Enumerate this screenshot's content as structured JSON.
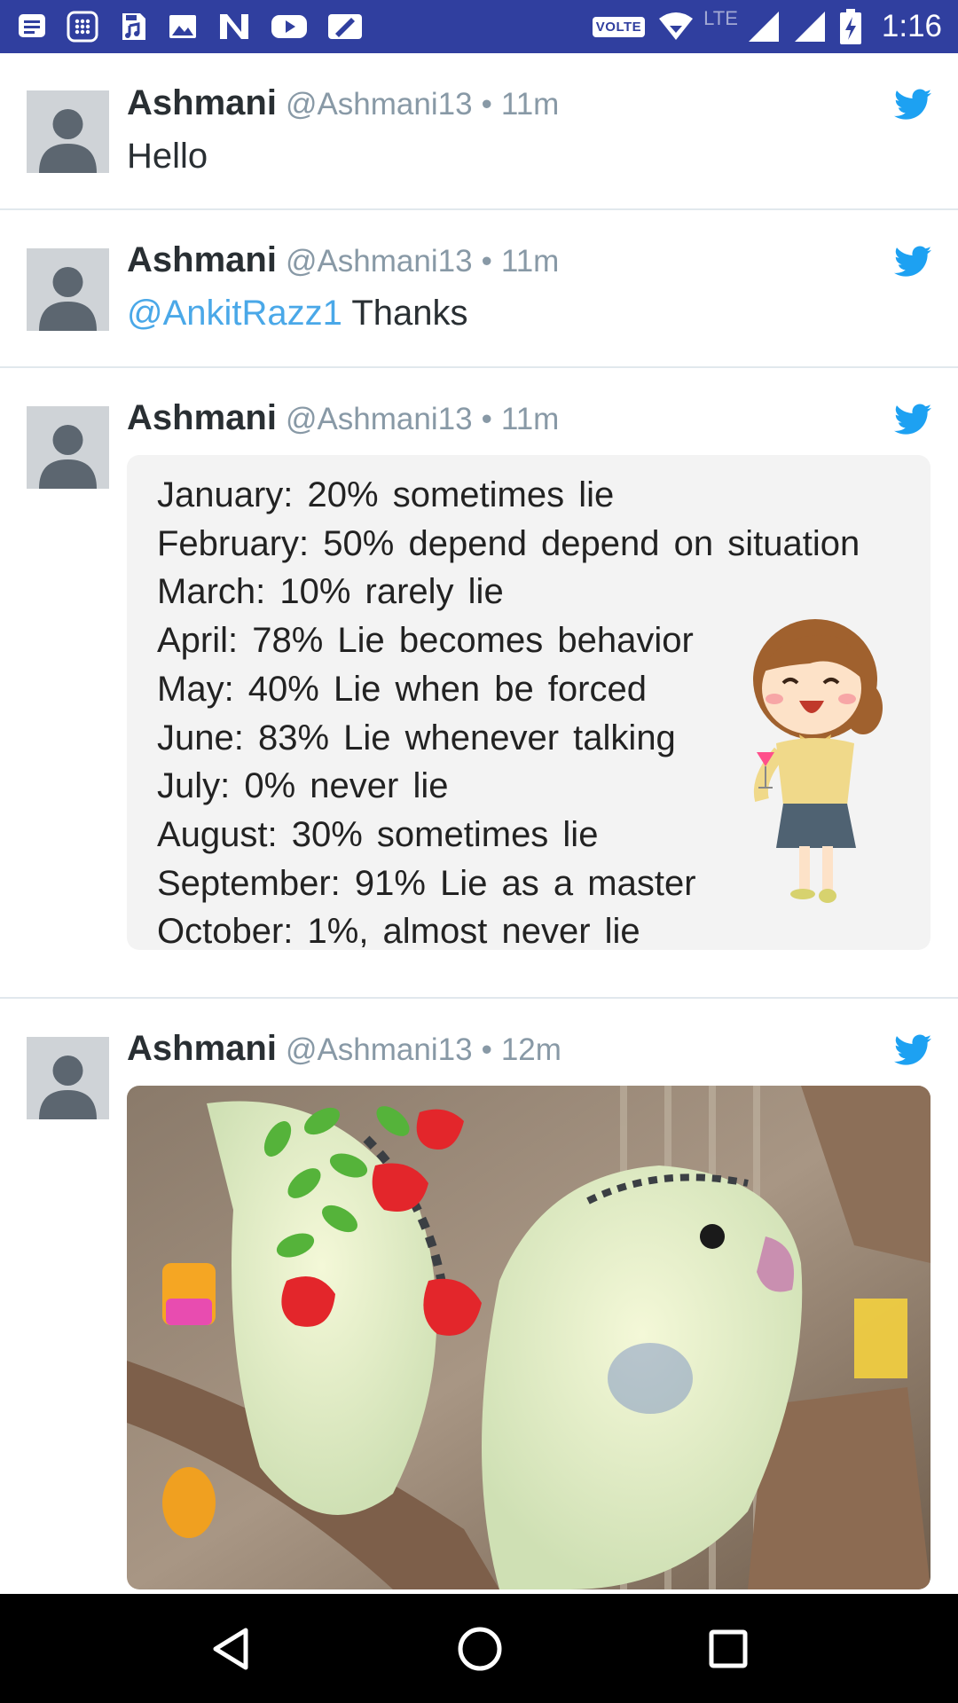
{
  "status_bar": {
    "left_icons": [
      "message-icon",
      "calendar-icon",
      "media-icon",
      "gallery-icon",
      "n-app-icon",
      "youtube-icon",
      "image-edit-icon"
    ],
    "volte": "VOLTE",
    "network": "LTE",
    "time": "1:16",
    "background": "#303f9f"
  },
  "tweets": [
    {
      "name": "Ashmani",
      "handle": "@Ashmani13",
      "separator": "•",
      "time": "11m",
      "text": "Hello"
    },
    {
      "name": "Ashmani",
      "handle": "@Ashmani13",
      "separator": "•",
      "time": "11m",
      "mention": "@AnkitRazz1",
      "text": "Thanks"
    },
    {
      "name": "Ashmani",
      "handle": "@Ashmani13",
      "separator": "•",
      "time": "11m",
      "image_lines": [
        "January: 20% sometimes lie",
        "February: 50% depend depend on situation",
        "March: 10% rarely lie",
        "April: 78% Lie becomes behavior",
        "May: 40% Lie when be forced",
        "June: 83% Lie whenever talking",
        "July: 0% never lie",
        "August: 30% sometimes lie",
        "September: 91% Lie as a master",
        "October: 1%, almost never lie"
      ]
    },
    {
      "name": "Ashmani",
      "handle": "@Ashmani13",
      "separator": "•",
      "time": "12m"
    }
  ],
  "colors": {
    "twitter_blue": "#1da1f2",
    "mention": "#4aa8e8",
    "handle_gray": "#8899a6",
    "name": "#292f33"
  },
  "nav_bar": {
    "buttons": [
      "back-icon",
      "home-icon",
      "recents-icon"
    ]
  }
}
